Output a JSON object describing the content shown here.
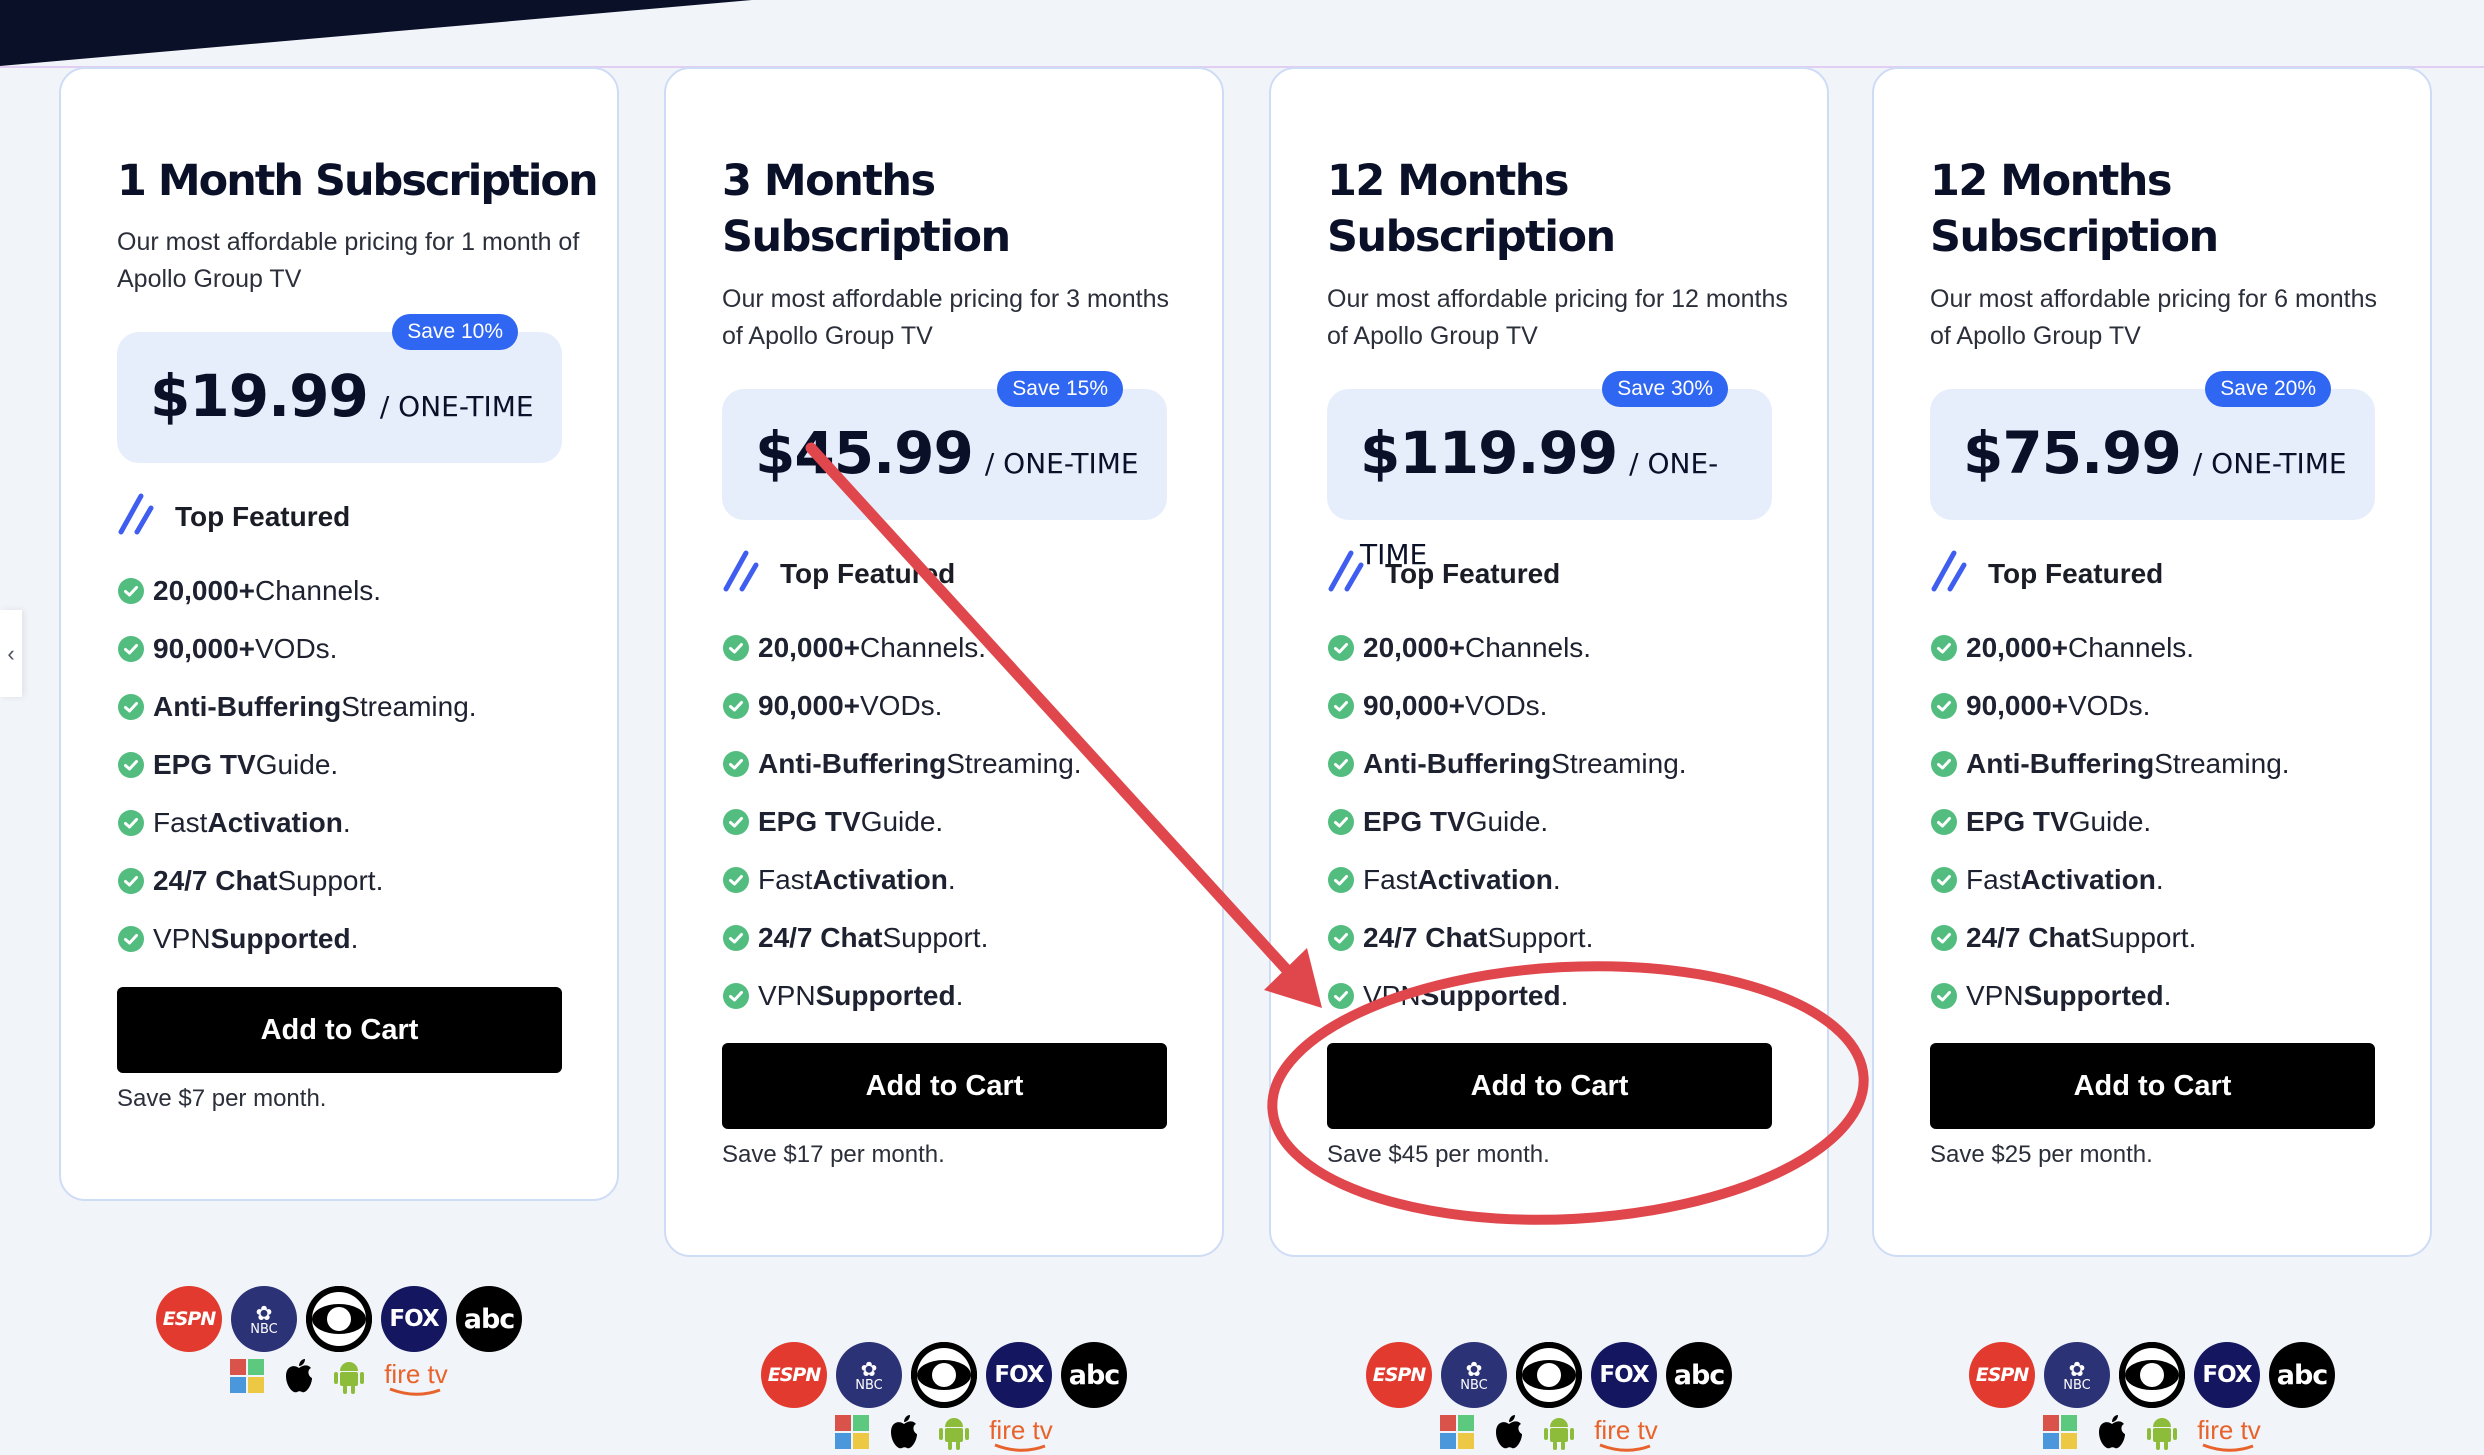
{
  "navigation": {
    "prev_icon": "chevron-left-icon",
    "prev_glyph": "‹"
  },
  "colors": {
    "hero_band": "#0b1029",
    "badge": "#2f66f2",
    "price_box": "#e6eefc",
    "check": "#52bd7f",
    "button": "#000000",
    "annotation": "#e0474c"
  },
  "plans": [
    {
      "title": "1 Month Subscription",
      "description": "Our most affordable pricing for 1 month of Apollo Group TV",
      "badge": "Save 10%",
      "price": "$19.99",
      "period": "/ ONE-TIME",
      "section_label": "Top Featured",
      "button_label": "Add to Cart",
      "save_note": "Save $7 per month."
    },
    {
      "title": "3 Months Subscription",
      "description": "Our most affordable pricing for 3 months of Apollo Group TV",
      "badge": "Save 15%",
      "price": "$45.99",
      "period": "/ ONE-TIME",
      "section_label": "Top Featured",
      "button_label": "Add to Cart",
      "save_note": "Save $17 per month."
    },
    {
      "title": "12 Months Subscription",
      "description": "Our most affordable pricing for 12 months of Apollo Group TV",
      "badge": "Save 30%",
      "price": "$119.99",
      "period": "/ ONE-TIME",
      "section_label": "Top Featured",
      "button_label": "Add to Cart",
      "save_note": "Save $45 per month.",
      "highlighted": true
    },
    {
      "title": "12 Months Subscription",
      "description": "Our most affordable pricing for 6 months of Apollo Group TV",
      "badge": "Save 20%",
      "price": "$75.99",
      "period": "/ ONE-TIME",
      "section_label": "Top Featured",
      "button_label": "Add to Cart",
      "save_note": "Save $25 per month."
    }
  ],
  "features": [
    {
      "bold": "20,000+",
      "text": " Channels.",
      "bold_first": true
    },
    {
      "bold": "90,000+",
      "text": " VODs.",
      "bold_first": true
    },
    {
      "bold": "Anti-Buffering",
      "text": " Streaming.",
      "bold_first": true
    },
    {
      "bold": "EPG TV",
      "text": " Guide.",
      "bold_first": true
    },
    {
      "text": "Fast ",
      "bold": "Activation",
      "suffix": ".",
      "bold_first": false
    },
    {
      "bold": "24/7 Chat",
      "text": " Support.",
      "bold_first": true
    },
    {
      "text": "VPN ",
      "bold": "Supported",
      "suffix": ".",
      "bold_first": false
    }
  ],
  "networks": [
    {
      "name": "ESPN",
      "label": "ESPN",
      "bg": "#e23a2e"
    },
    {
      "name": "NBC",
      "label": "NBC",
      "bg": "#2b3275"
    },
    {
      "name": "CBS",
      "label": "",
      "bg": "#000000"
    },
    {
      "name": "FOX",
      "label": "FOX",
      "bg": "#141660"
    },
    {
      "name": "ABC",
      "label": "abc",
      "bg": "#000000"
    }
  ],
  "platforms": [
    {
      "name": "windows"
    },
    {
      "name": "apple"
    },
    {
      "name": "android"
    },
    {
      "name": "firetv",
      "label": "fire tv"
    }
  ]
}
